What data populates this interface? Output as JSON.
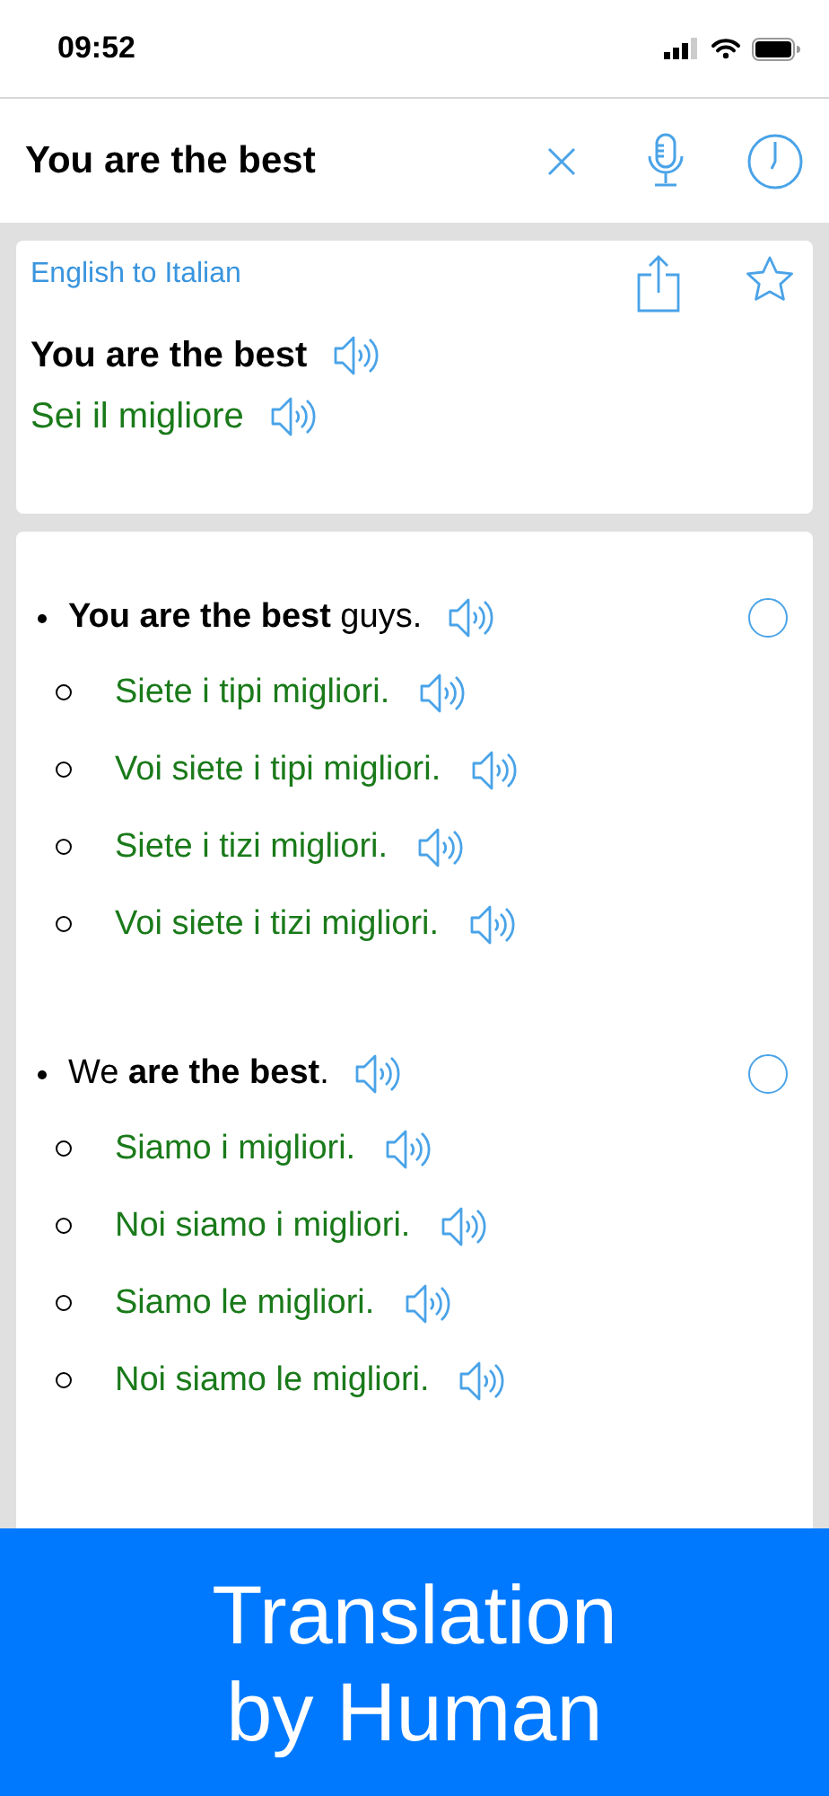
{
  "status_bar": {
    "time": "09:52"
  },
  "search": {
    "value": "You are the best"
  },
  "result": {
    "direction": "English to Italian",
    "source": "You are the best",
    "translation": "Sei il migliore"
  },
  "examples": [
    {
      "source": "**You are the best** guys.",
      "selected": false,
      "translations": [
        "Siete i tipi migliori.",
        "Voi siete i tipi migliori.",
        "Siete i tizi migliori.",
        "Voi siete i tizi migliori."
      ]
    },
    {
      "source": "We **are the best**.",
      "selected": false,
      "translations": [
        "Siamo i migliori.",
        "Noi siamo i migliori.",
        "Siamo le migliori.",
        "Noi siamo le migliori."
      ]
    }
  ],
  "banner": {
    "lines": [
      "Translation",
      "by Human"
    ]
  }
}
